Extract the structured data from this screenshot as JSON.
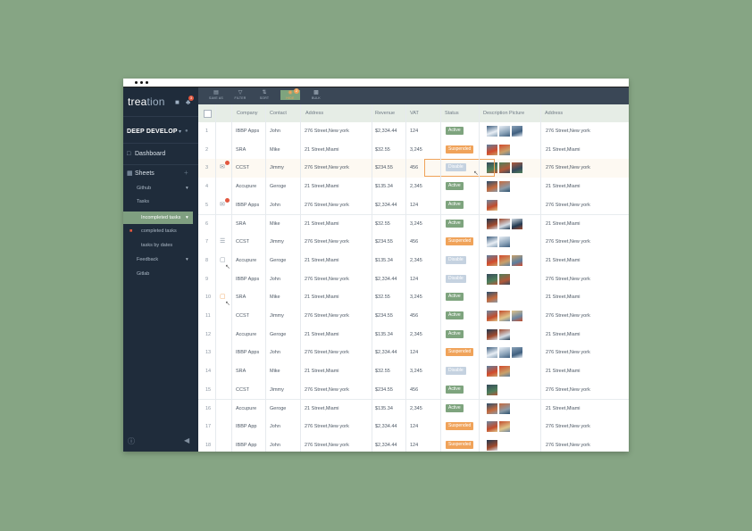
{
  "app": {
    "logo_bold": "trea",
    "logo_light": "tion",
    "notification_count": "3",
    "project": "DEEP DEVELOP"
  },
  "sidebar": {
    "dashboard": "Dashboard",
    "sheets": "Sheets",
    "sheets_add": "+",
    "groups": {
      "github": "Github",
      "tasks": "Tasks",
      "incompleted": "Incompleted tasks",
      "completed": "completed tasks",
      "by_dates": "tasks by dates",
      "feedback": "Feedback",
      "gitlab": "Gitlab"
    }
  },
  "toolbar": {
    "save_as": "SAVE AS",
    "filter": "FILTER",
    "sort": "SORT",
    "hide": "HIDE",
    "hide_badge": "2",
    "bulk": "BULK"
  },
  "table": {
    "headers": [
      "Company",
      "Contact",
      "Address",
      "Revenue",
      "VAT",
      "Status",
      "Description Picture",
      "Address"
    ],
    "rows": [
      {
        "n": "1",
        "company": "IBBP Apps",
        "contact": "John",
        "address": "276 Street,New york",
        "revenue": "$2,334.44",
        "vat": "124",
        "status": "Active",
        "address2": "276 Street,New york",
        "pics": 3,
        "icon": ""
      },
      {
        "n": "2",
        "company": "SRA",
        "contact": "Mike",
        "address": "21 Street,Miami",
        "revenue": "$32.55",
        "vat": "3,245",
        "status": "Suspended",
        "address2": "21 Street,Miami",
        "pics": 2,
        "icon": ""
      },
      {
        "n": "3",
        "company": "CCST",
        "contact": "Jimmy",
        "address": "276 Street,New york",
        "revenue": "$234.55",
        "vat": "456",
        "status": "Disable",
        "address2": "276 Street,New york",
        "pics": 3,
        "icon": "comment"
      },
      {
        "n": "4",
        "company": "Accupure",
        "contact": "Geroge",
        "address": "21 Street,Miami",
        "revenue": "$135.34",
        "vat": "2,345",
        "status": "Active",
        "address2": "21 Street,Miami",
        "pics": 2,
        "icon": ""
      },
      {
        "n": "5",
        "company": "IBBP Apps",
        "contact": "John",
        "address": "276 Street,New york",
        "revenue": "$2,334.44",
        "vat": "124",
        "status": "Active",
        "address2": "276 Street,New york",
        "pics": 1,
        "icon": "comment"
      },
      {
        "n": "6",
        "company": "SRA",
        "contact": "Mike",
        "address": "21 Street,Miami",
        "revenue": "$32.55",
        "vat": "3,245",
        "status": "Active",
        "address2": "21 Street,Miami",
        "pics": 3,
        "icon": ""
      },
      {
        "n": "7",
        "company": "CCST",
        "contact": "Jimmy",
        "address": "276 Street,New york",
        "revenue": "$234.55",
        "vat": "456",
        "status": "Suspended",
        "address2": "276 Street,New york",
        "pics": 2,
        "icon": "note"
      },
      {
        "n": "8",
        "company": "Accupure",
        "contact": "Geroge",
        "address": "21 Street,Miami",
        "revenue": "$135.34",
        "vat": "2,345",
        "status": "Disable",
        "address2": "21 Street,Miami",
        "pics": 3,
        "icon": "doc"
      },
      {
        "n": "9",
        "company": "IBBP Apps",
        "contact": "John",
        "address": "276 Street,New york",
        "revenue": "$2,334.44",
        "vat": "124",
        "status": "Disable",
        "address2": "276 Street,New york",
        "pics": 2,
        "icon": ""
      },
      {
        "n": "10",
        "company": "SRA",
        "contact": "Mike",
        "address": "21 Street,Miami",
        "revenue": "$32.55",
        "vat": "3,245",
        "status": "Active",
        "address2": "21 Street,Miami",
        "pics": 1,
        "icon": "docorange"
      },
      {
        "n": "11",
        "company": "CCST",
        "contact": "Jimmy",
        "address": "276 Street,New york",
        "revenue": "$234.55",
        "vat": "456",
        "status": "Active",
        "address2": "276 Street,New york",
        "pics": 3,
        "icon": ""
      },
      {
        "n": "12",
        "company": "Accupure",
        "contact": "Geroge",
        "address": "21 Street,Miami",
        "revenue": "$135.34",
        "vat": "2,345",
        "status": "Active",
        "address2": "21 Street,Miami",
        "pics": 2,
        "icon": ""
      },
      {
        "n": "13",
        "company": "IBBP Apps",
        "contact": "John",
        "address": "276 Street,New york",
        "revenue": "$2,334.44",
        "vat": "124",
        "status": "Suspended",
        "address2": "276 Street,New york",
        "pics": 3,
        "icon": ""
      },
      {
        "n": "14",
        "company": "SRA",
        "contact": "Mike",
        "address": "21 Street,Miami",
        "revenue": "$32.55",
        "vat": "3,245",
        "status": "Disable",
        "address2": "21 Street,Miami",
        "pics": 2,
        "icon": ""
      },
      {
        "n": "15",
        "company": "CCST",
        "contact": "Jimmy",
        "address": "276 Street,New york",
        "revenue": "$234.55",
        "vat": "456",
        "status": "Active",
        "address2": "276 Street,New york",
        "pics": 1,
        "icon": ""
      },
      {
        "n": "16",
        "company": "Accupure",
        "contact": "Geroge",
        "address": "21 Street,Miami",
        "revenue": "$135.34",
        "vat": "2,345",
        "status": "Active",
        "address2": "21 Street,Miami",
        "pics": 2,
        "icon": ""
      },
      {
        "n": "17",
        "company": "IBBP App",
        "contact": "John",
        "address": "276 Street,New york",
        "revenue": "$2,334.44",
        "vat": "124",
        "status": "Suspended",
        "address2": "276 Street,New york",
        "pics": 2,
        "icon": ""
      },
      {
        "n": "18",
        "company": "IBBP App",
        "contact": "John",
        "address": "276 Street,New york",
        "revenue": "$2,334.44",
        "vat": "124",
        "status": "Suspended",
        "address2": "276 Street,New york",
        "pics": 1,
        "icon": ""
      }
    ]
  },
  "colors": {
    "background": "#86a584",
    "sidebar": "#1f2c3b",
    "toolbar": "#3a4756",
    "accent_green": "#7ea47e",
    "accent_orange": "#f0a35a",
    "disable": "#c5d2e0"
  }
}
